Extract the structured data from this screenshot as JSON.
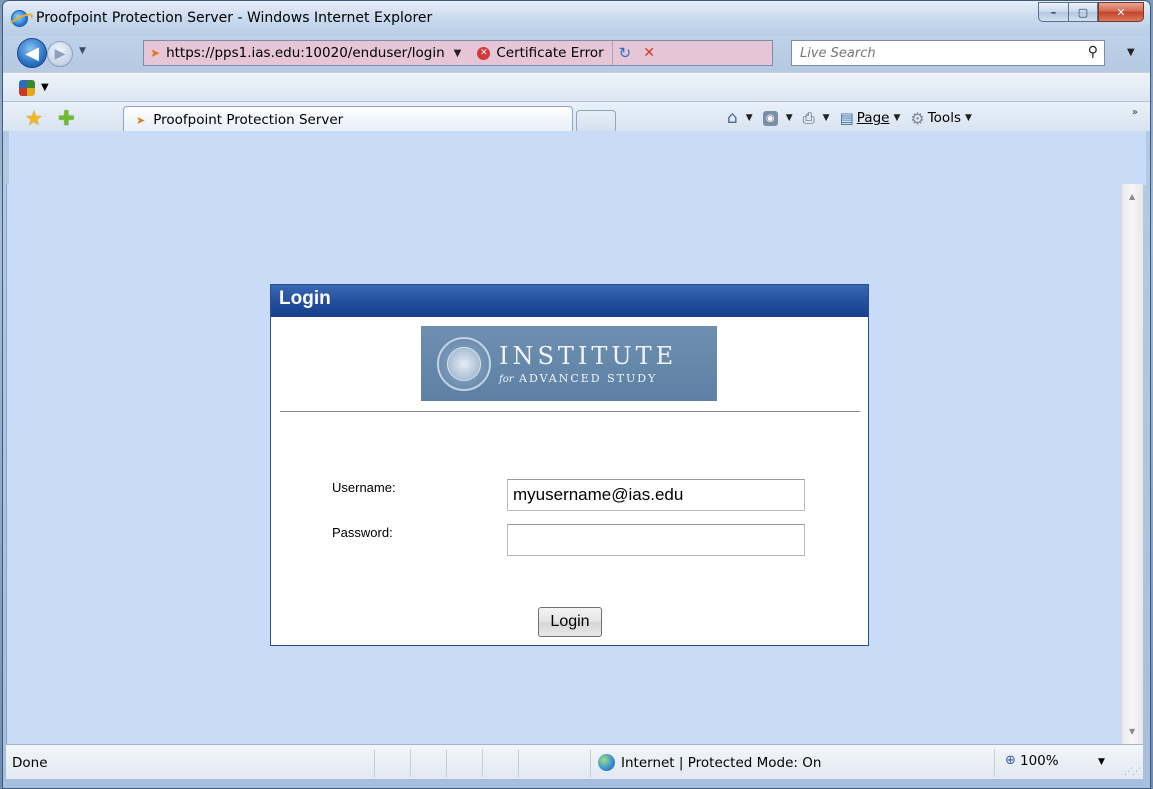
{
  "window": {
    "title": "Proofpoint Protection Server - Windows Internet Explorer",
    "minimize_glyph": "–",
    "maximize_glyph": "▢",
    "close_glyph": "✕"
  },
  "address": {
    "url": "https://pps1.ias.edu:10020/enduser/login",
    "certificate_error": "Certificate Error",
    "search_placeholder": "Live Search"
  },
  "tab": {
    "title": "Proofpoint Protection Server"
  },
  "command_bar": {
    "page": "Page",
    "tools": "Tools"
  },
  "login": {
    "header": "Login",
    "logo_line1": "INSTITUTE",
    "logo_for": "for",
    "logo_line2": "ADVANCED STUDY",
    "username_label": "Username:",
    "username_value": "myusername@ias.edu",
    "password_label": "Password:",
    "password_value": "",
    "submit_label": "Login"
  },
  "status": {
    "text": "Done",
    "zone": "Internet | Protected Mode: On",
    "zoom": "100%"
  },
  "icons": {
    "ie": "ie-logo-icon",
    "back": "back-arrow-icon",
    "forward": "forward-arrow-icon",
    "certificate": "certificate-error-icon",
    "refresh": "refresh-icon",
    "stop": "stop-icon",
    "search": "search-icon",
    "favorites": "favorites-star-icon",
    "add_favorite": "add-favorite-icon",
    "home": "home-icon",
    "feeds": "feeds-icon",
    "print": "print-icon",
    "page": "page-icon",
    "tools": "gear-icon",
    "globe": "globe-icon",
    "zoom": "zoom-icon"
  },
  "colors": {
    "login_header": "#24509e",
    "page_background": "#c8dcf7",
    "address_error_tint": "#e6c6d6"
  }
}
